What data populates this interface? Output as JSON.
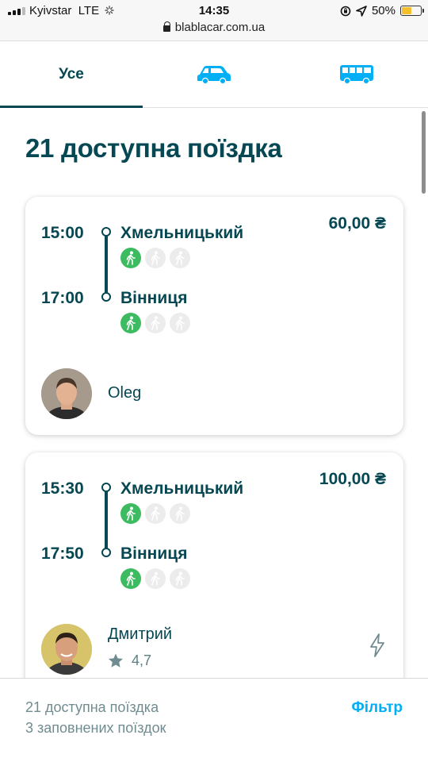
{
  "status_bar": {
    "carrier": "Kyivstar",
    "network": "LTE",
    "time": "14:35",
    "battery": "50%",
    "battery_level": 0.5,
    "url": "blablacar.com.ua"
  },
  "tabs": [
    {
      "label": "Усе",
      "icon": null,
      "active": true
    },
    {
      "label": "",
      "icon": "car-icon",
      "active": false
    },
    {
      "label": "",
      "icon": "bus-icon",
      "active": false
    }
  ],
  "colors": {
    "brand": "#054752",
    "accent": "#00aff5",
    "seat_available": "#3dbb61"
  },
  "main": {
    "title": "21 доступна поїздка",
    "trips": [
      {
        "departure_time": "15:00",
        "departure_city": "Хмельницький",
        "arrival_time": "17:00",
        "arrival_city": "Вінниця",
        "price": "60,00 ₴",
        "seats_total": 3,
        "seats_available": 1,
        "driver": {
          "name": "Oleg",
          "rating": null
        }
      },
      {
        "departure_time": "15:30",
        "departure_city": "Хмельницький",
        "arrival_time": "17:50",
        "arrival_city": "Вінниця",
        "price": "100,00 ₴",
        "seats_total": 3,
        "seats_available": 1,
        "driver": {
          "name": "Дмитрий",
          "rating": "4,7"
        },
        "instant_booking_icon": "lightning-icon"
      }
    ]
  },
  "footer": {
    "available_text": "21 доступна поїздка",
    "full_text": "3 заповнених поїздок",
    "filter_label": "Фільтр"
  }
}
